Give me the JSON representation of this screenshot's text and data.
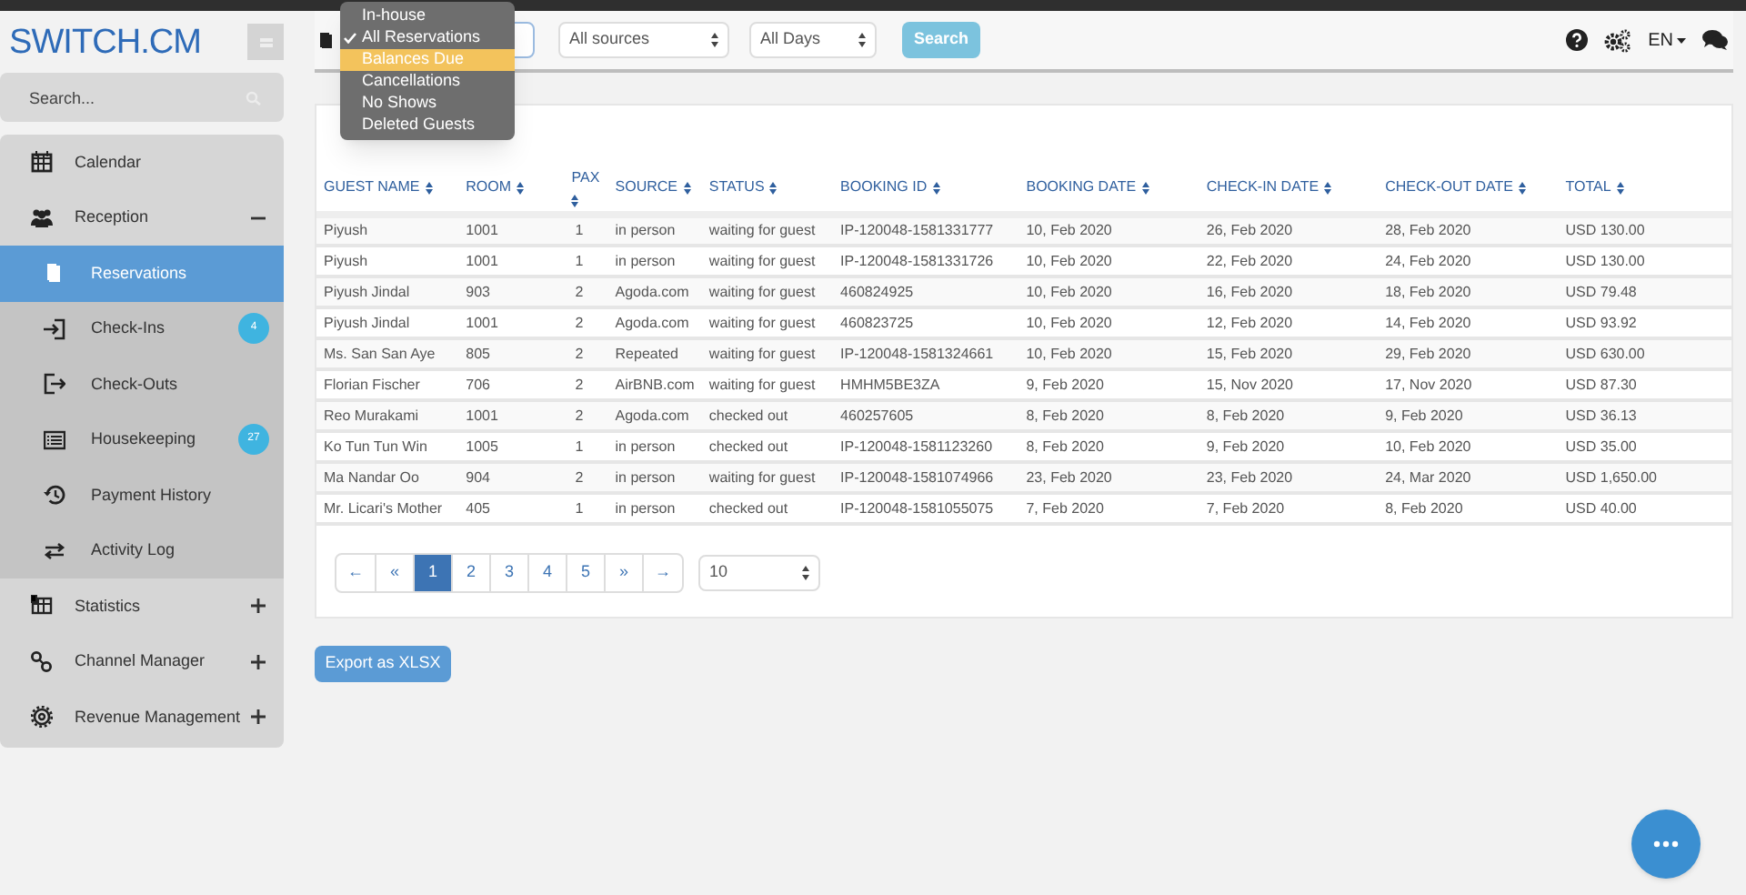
{
  "logo": "SWITCH.CM",
  "sidebar": {
    "search": {
      "placeholder": "Search..."
    },
    "items": [
      {
        "label": "Calendar",
        "kind": "item"
      },
      {
        "label": "Reception",
        "kind": "group",
        "expanded": true,
        "children": [
          {
            "label": "Reservations",
            "selected": true
          },
          {
            "label": "Check-Ins",
            "selected": false,
            "badge": "4"
          },
          {
            "label": "Check-Outs",
            "selected": false
          },
          {
            "label": "Housekeeping",
            "selected": false,
            "badge": "27"
          },
          {
            "label": "Payment History",
            "selected": false
          },
          {
            "label": "Activity Log",
            "selected": false
          }
        ]
      },
      {
        "label": "Statistics",
        "kind": "group",
        "expanded": false
      },
      {
        "label": "Channel Manager",
        "kind": "group",
        "expanded": false
      },
      {
        "label": "Revenue Management",
        "kind": "group",
        "expanded": false
      }
    ]
  },
  "toolbar": {
    "type_menu": [
      {
        "label": "In-house",
        "selected": false,
        "highlighted": false
      },
      {
        "label": "All Reservations",
        "selected": true,
        "highlighted": false
      },
      {
        "label": "Balances Due",
        "selected": false,
        "highlighted": true
      },
      {
        "label": "Cancellations",
        "selected": false,
        "highlighted": false
      },
      {
        "label": "No Shows",
        "selected": false,
        "highlighted": false
      },
      {
        "label": "Deleted Guests",
        "selected": false,
        "highlighted": false
      }
    ],
    "source_select": "All sources",
    "days_select": "All Days",
    "search_button": "Search",
    "language": "EN"
  },
  "table": {
    "columns": [
      "GUEST NAME",
      "ROOM",
      "PAX",
      "SOURCE",
      "STATUS",
      "BOOKING ID",
      "BOOKING DATE",
      "CHECK-IN DATE",
      "CHECK-OUT DATE",
      "TOTAL"
    ],
    "rows": [
      [
        "Piyush",
        "1001",
        "1",
        "in person",
        "waiting for guest",
        "IP-120048-1581331777",
        "10, Feb 2020",
        "26, Feb 2020",
        "28, Feb 2020",
        "USD 130.00"
      ],
      [
        "Piyush",
        "1001",
        "1",
        "in person",
        "waiting for guest",
        "IP-120048-1581331726",
        "10, Feb 2020",
        "22, Feb 2020",
        "24, Feb 2020",
        "USD 130.00"
      ],
      [
        "Piyush Jindal",
        "903",
        "2",
        "Agoda.com",
        "waiting for guest",
        "460824925",
        "10, Feb 2020",
        "16, Feb 2020",
        "18, Feb 2020",
        "USD 79.48"
      ],
      [
        "Piyush Jindal",
        "1001",
        "2",
        "Agoda.com",
        "waiting for guest",
        "460823725",
        "10, Feb 2020",
        "12, Feb 2020",
        "14, Feb 2020",
        "USD 93.92"
      ],
      [
        "Ms. San San Aye",
        "805",
        "2",
        "Repeated",
        "waiting for guest",
        "IP-120048-1581324661",
        "10, Feb 2020",
        "15, Feb 2020",
        "29, Feb 2020",
        "USD 630.00"
      ],
      [
        "Florian Fischer",
        "706",
        "2",
        "AirBNB.com",
        "waiting for guest",
        "HMHM5BE3ZA",
        "9, Feb 2020",
        "15, Nov 2020",
        "17, Nov 2020",
        "USD 87.30"
      ],
      [
        "Reo Murakami",
        "1001",
        "2",
        "Agoda.com",
        "checked out",
        "460257605",
        "8, Feb 2020",
        "8, Feb 2020",
        "9, Feb 2020",
        "USD 36.13"
      ],
      [
        "Ko Tun Tun Win",
        "1005",
        "1",
        "in person",
        "checked out",
        "IP-120048-1581123260",
        "8, Feb 2020",
        "9, Feb 2020",
        "10, Feb 2020",
        "USD 35.00"
      ],
      [
        "Ma Nandar Oo",
        "904",
        "2",
        "in person",
        "waiting for guest",
        "IP-120048-1581074966",
        "23, Feb 2020",
        "23, Feb 2020",
        "24, Mar 2020",
        "USD 1,650.00"
      ],
      [
        "Mr. Licari's Mother",
        "405",
        "1",
        "in person",
        "checked out",
        "IP-120048-1581055075",
        "7, Feb 2020",
        "7, Feb 2020",
        "8, Feb 2020",
        "USD 40.00"
      ]
    ]
  },
  "pagination": {
    "pages": [
      {
        "label": "←",
        "selected": false
      },
      {
        "label": "«",
        "selected": false
      },
      {
        "label": "1",
        "selected": true
      },
      {
        "label": "2",
        "selected": false
      },
      {
        "label": "3",
        "selected": false
      },
      {
        "label": "4",
        "selected": false
      },
      {
        "label": "5",
        "selected": false
      },
      {
        "label": "»",
        "selected": false
      },
      {
        "label": "→",
        "selected": false
      }
    ],
    "page_size": "10"
  },
  "export_button": "Export as XLSX"
}
